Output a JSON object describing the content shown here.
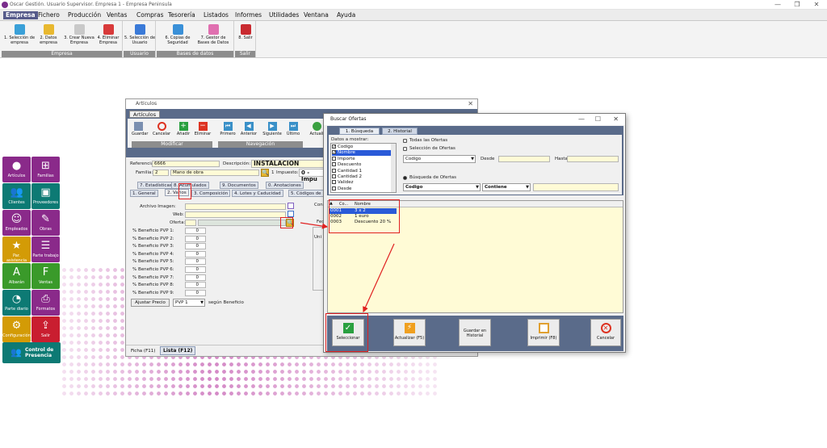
{
  "window": {
    "title": "Oscar Gestión. Usuario Supervisor. Empresa 1 - Empresa Peninsula"
  },
  "menu": [
    "Empresa",
    "Fichero",
    "Producción",
    "Ventas",
    "Compras",
    "Tesorería",
    "Listados",
    "Informes",
    "Utilidades",
    "Ventana",
    "Ayuda"
  ],
  "ribbon": {
    "groups": [
      {
        "label": "Empresa",
        "buttons": [
          "1. Selección de empresa",
          "2. Datos empresa",
          "3. Crear Nueva Empresa",
          "4. Eliminar Empresa"
        ]
      },
      {
        "label": "Usuario",
        "buttons": [
          "5. Selección de Usuario"
        ]
      },
      {
        "label": "Bases de datos",
        "buttons": [
          "6. Copias de Seguridad",
          "7. Gestor de Bases de Datos"
        ]
      },
      {
        "label": "Salir",
        "buttons": [
          "8. Salir"
        ]
      }
    ]
  },
  "tiles": [
    {
      "label": "Artículos",
      "icon": "people-circles-icon",
      "color": "#8a2a8a",
      "cls": "purple",
      "glyph": "●"
    },
    {
      "label": "Familias",
      "icon": "hierarchy-icon",
      "color": "#8a2a8a",
      "cls": "purple",
      "glyph": "⊞"
    },
    {
      "label": "Clientes",
      "icon": "users-icon",
      "color": "#0d7a74",
      "cls": "teal",
      "glyph": "👥"
    },
    {
      "label": "Proveedores",
      "icon": "supplier-icon",
      "color": "#0d7a74",
      "cls": "teal",
      "glyph": "▣"
    },
    {
      "label": "Empleados",
      "icon": "employee-icon",
      "color": "#8a2a8a",
      "cls": "purple",
      "glyph": "☺"
    },
    {
      "label": "Obras",
      "icon": "works-icon",
      "color": "#8a2a8a",
      "cls": "purple",
      "glyph": "✎"
    },
    {
      "label": "Par. asistencia",
      "icon": "star-icon",
      "color": "#d39b06",
      "cls": "gold",
      "glyph": "★"
    },
    {
      "label": "Parte trabajo",
      "icon": "worksheet-icon",
      "color": "#8a2a8a",
      "cls": "purple",
      "glyph": "☰"
    },
    {
      "label": "Albarán",
      "icon": "delivery-note-icon",
      "color": "#3a9a2a",
      "cls": "green",
      "glyph": "A"
    },
    {
      "label": "Ventas",
      "icon": "sales-icon",
      "color": "#3a9a2a",
      "cls": "green",
      "glyph": "F"
    },
    {
      "label": "Parte diario",
      "icon": "pie-chart-icon",
      "color": "#0d7a74",
      "cls": "teal",
      "glyph": "◔"
    },
    {
      "label": "Formatos",
      "icon": "print-icon",
      "color": "#8a2a8a",
      "cls": "purple",
      "glyph": "⎙"
    },
    {
      "label": "Configuración",
      "icon": "gears-icon",
      "color": "#d39b06",
      "cls": "gold",
      "glyph": "⚙"
    },
    {
      "label": "Salir",
      "icon": "exit-icon",
      "color": "#c91e30",
      "cls": "red",
      "glyph": "⇪"
    }
  ],
  "control_presencia": "Control de Presencia",
  "articulos": {
    "title": "Artículos",
    "tab": "Artículos",
    "toolbar": [
      "Guardar",
      "Cancelar",
      "Añadir",
      "Eliminar",
      "Primero",
      "Anterior",
      "Siguiente",
      "Último",
      "Actuali"
    ],
    "groups": [
      "Modificar",
      "Navegación"
    ],
    "referencia_label": "Referencia:",
    "referencia": "6666",
    "descripcion_label": "Descripción:",
    "descripcion": "INSTALACION",
    "familia_label": "Familia:",
    "familia_code": "2",
    "familia": "Mano de obra",
    "impuesto_label": "Impuesto:",
    "impuesto_code": "1",
    "impuesto": "0 - Impu",
    "tabs_row1": [
      "7. Estadísticas",
      "8. Acumulados",
      "9. Documentos",
      "0. Anotaciones"
    ],
    "tabs_row2": [
      "1. General",
      "2. Varios",
      "3. Composición",
      "4. Lotes y Caducidad",
      "5. Códigos de"
    ],
    "archivo_label": "Archivo Imagen:",
    "web_label": "Web:",
    "oferta_label": "Oferta:",
    "beneficios": [
      {
        "label": "% Beneficio PVP 1:",
        "value": "0"
      },
      {
        "label": "% Beneficio PVP 2:",
        "value": "0"
      },
      {
        "label": "% Beneficio PVP 3:",
        "value": "0"
      },
      {
        "label": "% Beneficio PVP 4:",
        "value": "0"
      },
      {
        "label": "% Beneficio PVP 5:",
        "value": "0"
      },
      {
        "label": "% Beneficio PVP 6:",
        "value": "0"
      },
      {
        "label": "% Beneficio PVP 7:",
        "value": "0"
      },
      {
        "label": "% Beneficio PVP 8:",
        "value": "0"
      },
      {
        "label": "% Beneficio PVP 9:",
        "value": "0"
      }
    ],
    "ajustar_label": "Ajustar Precio",
    "pvp_select": "PVP 1",
    "segun": "según Beneficio",
    "right_labels": [
      "Con",
      "Fec",
      "Uni"
    ],
    "bottom_tabs": [
      "Ficha (F11)",
      "Lista (F12)"
    ]
  },
  "ofertas": {
    "title": "Buscar Ofertas",
    "tabs": [
      "1. Búsqueda",
      "2. Historial"
    ],
    "datos_label": "Datos a mostrar:",
    "datos": [
      {
        "label": "Codigo",
        "checked": true,
        "selected": false
      },
      {
        "label": "Nombre",
        "checked": true,
        "selected": true
      },
      {
        "label": "Importe",
        "checked": false,
        "selected": false
      },
      {
        "label": "Descuento",
        "checked": false,
        "selected": false
      },
      {
        "label": "Cantidad 1",
        "checked": false,
        "selected": false
      },
      {
        "label": "Cantidad 2",
        "checked": false,
        "selected": false
      },
      {
        "label": "Validez",
        "checked": false,
        "selected": false
      },
      {
        "label": "Desde",
        "checked": false,
        "selected": false
      }
    ],
    "todas": "Todas las Ofertas",
    "seleccion": "Selección de Ofertas",
    "codigo_select": "Codigo",
    "desde_label": "Desde",
    "hasta_label": "Hasta",
    "busqueda_label": "Búsqueda de Ofertas",
    "campo_select": "Codigo",
    "modo_select": "Contiene",
    "columns": [
      "Co...",
      "Nombre"
    ],
    "rows": [
      {
        "codigo": "0001",
        "nombre": "3 x 2",
        "selected": true
      },
      {
        "codigo": "0002",
        "nombre": "1 euro",
        "selected": false
      },
      {
        "codigo": "0003",
        "nombre": "Descuento 20 %",
        "selected": false
      }
    ],
    "buttons": [
      "Seleccionar",
      "Actualizar (F5)",
      "Guardar en Historial",
      "Imprimir (F8)",
      "Cancelar"
    ]
  }
}
